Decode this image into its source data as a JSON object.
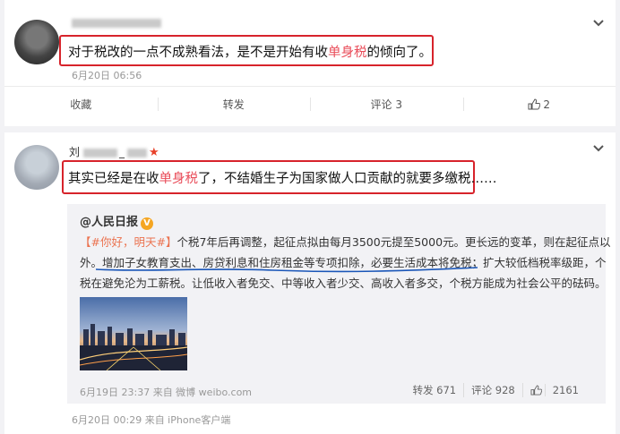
{
  "post1": {
    "username_tail": "",
    "text_before": "对于税改的一点不成熟看法，是不是开始有收",
    "text_highlight": "单身税",
    "text_after": "的倾向了。",
    "timestamp": "6月20日 06:56",
    "actions": {
      "favorite": "收藏",
      "repost": "转发",
      "comment": "评论 3",
      "like_count": "2"
    }
  },
  "post2": {
    "username_prefix": "刘",
    "username_sep": "_",
    "text_before": "其实已经是在收",
    "text_highlight": "单身税",
    "text_after": "了，不结婚生子为国家做人口贡献的就要多缴税……",
    "timestamp": "6月20日 00:29 来自 iPhone客户端",
    "retweet": {
      "author": "@人民日报",
      "verified_badge": "V",
      "hashtag": "【#你好，明天#】",
      "line1": "个税7年后再调整，起征点拟由每月3500元提至5000元。更长远的变革，则在起征点以",
      "line2": "外。增加子女教育支出、房贷利息和住房租金等专项扣除，必要生活成本将免税；扩大较低档税率级距，个",
      "line3": "税在避免沦为工薪税。让低收入者免交、中等收入者少交、高收入者多交，个税方能成为社会公平的砝码。",
      "footer": "6月19日 23:37 来自 微博 weibo.com",
      "repost": "转发 671",
      "comment": "评论 928",
      "like": "2161"
    }
  },
  "colors": {
    "red_box": "#d7232b",
    "highlight": "#e94d5a",
    "underline": "#1a56b8"
  },
  "icons": [
    "chevron-down-icon",
    "thumbs-up-icon",
    "verified-badge-icon"
  ]
}
